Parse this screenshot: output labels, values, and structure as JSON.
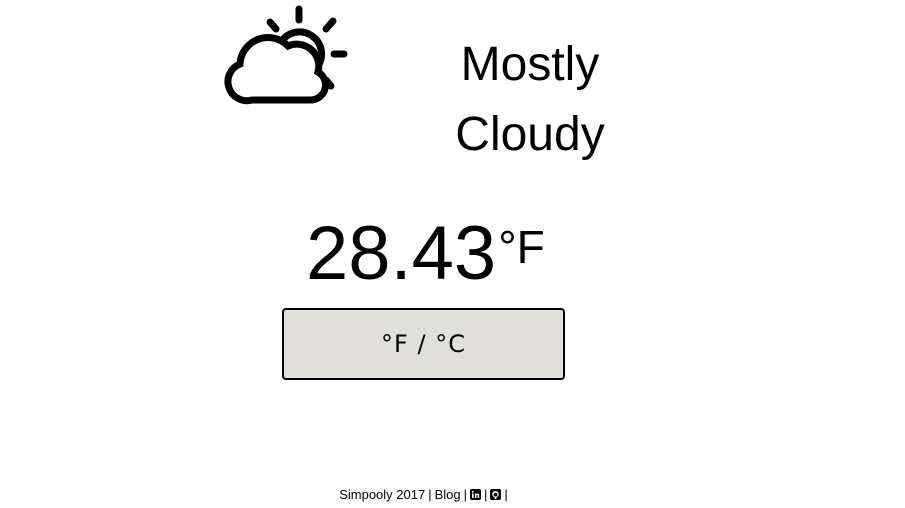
{
  "weather": {
    "icon": "partly-cloudy-icon",
    "condition_line1": "Mostly",
    "condition_line2": "Cloudy",
    "temperature": "28.43",
    "unit": "°F"
  },
  "toggle": {
    "label": "°F / °C"
  },
  "footer": {
    "credit": "Simpooly 2017",
    "blog_label": "Blog",
    "linkedin_icon": "linkedin-icon",
    "github_icon": "github-icon",
    "separator": "|"
  }
}
